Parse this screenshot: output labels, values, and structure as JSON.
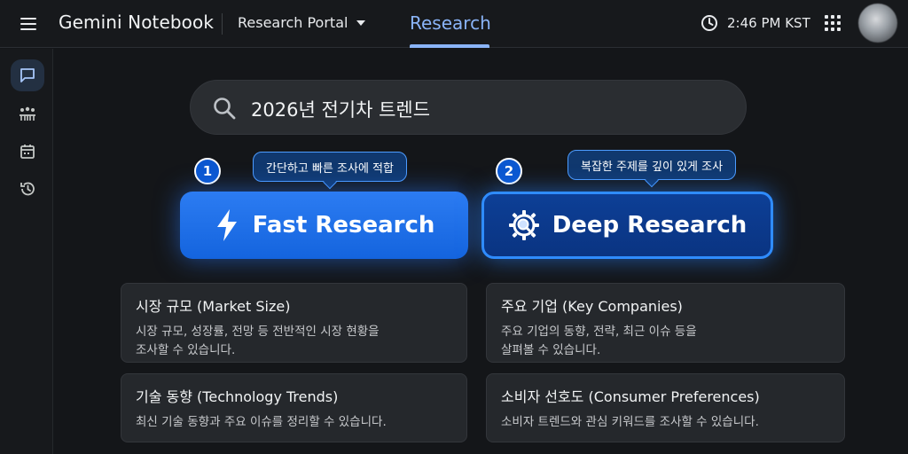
{
  "header": {
    "app_title": "Gemini Notebook",
    "portal": "Research Portal",
    "active_tab": "Research",
    "time": "2:46 PM KST",
    "accent_color": "#8ab4f8"
  },
  "rail": {
    "items": [
      {
        "icon": "chat-icon",
        "active": true
      },
      {
        "icon": "community-icon",
        "active": false
      },
      {
        "icon": "calendar-icon",
        "active": false
      },
      {
        "icon": "history-icon",
        "active": false
      }
    ]
  },
  "search": {
    "query": "2026년 전기차 트렌드"
  },
  "modes": {
    "fast": {
      "number": "1",
      "tooltip": "간단하고 빠른 조사에 적합",
      "label": "Fast Research",
      "icon": "lightning-icon"
    },
    "deep": {
      "number": "2",
      "tooltip": "복잡한 주제를 깊이 있게 조사",
      "label": "Deep Research",
      "icon": "gear-magnifier-icon"
    }
  },
  "cards": [
    {
      "title": "시장 규모 (Market Size)",
      "desc": "시장 규모, 성장률, 전망 등 전반적인 시장 현황을\n조사할 수 있습니다."
    },
    {
      "title": "주요 기업 (Key Companies)",
      "desc": "주요 기업의 동향, 전략, 최근 이슈 등을\n살펴볼 수 있습니다."
    },
    {
      "title": "기술 동향 (Technology Trends)",
      "desc": "최신 기술 동향과 주요 이슈를 정리할 수 있습니다."
    },
    {
      "title": "소비자 선호도 (Consumer Preferences)",
      "desc": "소비자 트렌드와 관심 키워드를 조사할 수 있습니다."
    }
  ]
}
